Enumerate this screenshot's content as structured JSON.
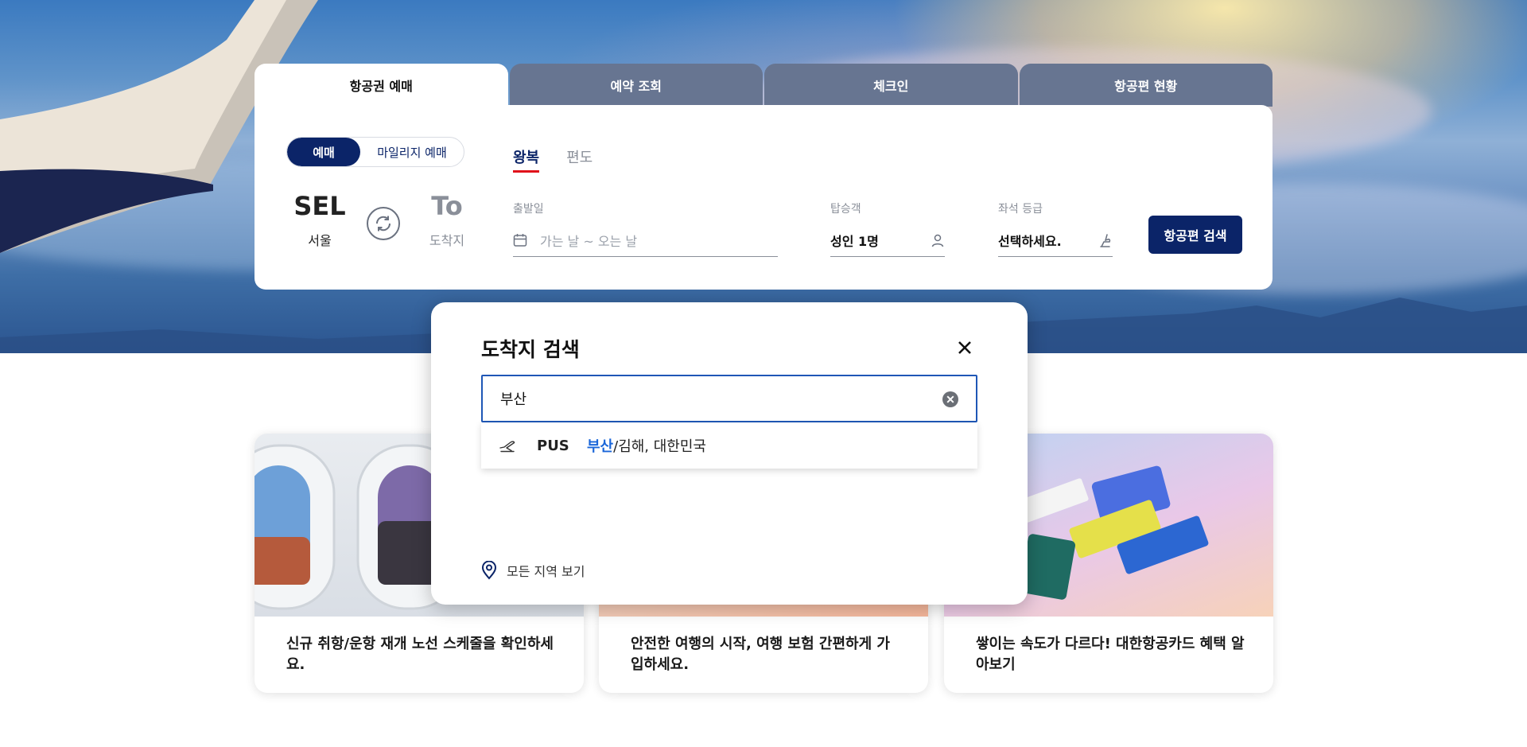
{
  "tabs": [
    {
      "label": "항공권 예매",
      "active": true
    },
    {
      "label": "예약 조회",
      "active": false
    },
    {
      "label": "체크인",
      "active": false
    },
    {
      "label": "항공편 현황",
      "active": false
    }
  ],
  "booking": {
    "segment": {
      "on": "예매",
      "off": "마일리지 예매"
    },
    "trip_types": {
      "round": "왕복",
      "oneway": "편도"
    },
    "origin": {
      "code": "SEL",
      "city": "서울"
    },
    "destination": {
      "code": "To",
      "city": "도착지"
    },
    "date": {
      "label": "출발일",
      "placeholder": "가는 날 ~ 오는 날"
    },
    "passengers": {
      "label": "탑승객",
      "value": "성인 1명"
    },
    "cabin": {
      "label": "좌석 등급",
      "value": "선택하세요."
    },
    "search_button": "항공편 검색"
  },
  "cards": [
    {
      "caption": "신규 취항/운항 재개 노선 스케줄을 확인하세요."
    },
    {
      "caption": "안전한 여행의 시작, 여행 보험 간편하게 가입하세요."
    },
    {
      "caption": "쌓이는 속도가 다르다! 대한항공카드 혜택 알아보기"
    }
  ],
  "modal": {
    "title": "도착지 검색",
    "query": "부산",
    "result": {
      "code": "PUS",
      "highlight": "부산",
      "rest": "/김해, 대한민국"
    },
    "all_regions": "모든 지역 보기"
  },
  "colors": {
    "navy": "#0b2468",
    "tab_inactive": "#677591",
    "accent_red": "#e0111b",
    "link_blue": "#1a66d9"
  },
  "icons": [
    "refresh-swap-icon",
    "calendar-icon",
    "person-icon",
    "seat-icon",
    "close-icon",
    "clear-icon",
    "departure-plane-icon",
    "location-pin-icon"
  ]
}
